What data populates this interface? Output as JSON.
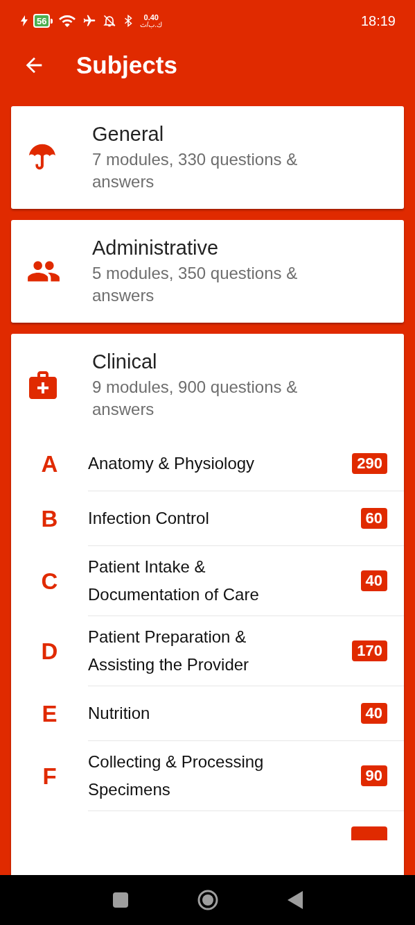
{
  "status_bar": {
    "battery": "56",
    "speed": "0.40",
    "speed_unit": "ك.ب/ث",
    "time": "18:19"
  },
  "app_bar": {
    "title": "Subjects"
  },
  "subjects": [
    {
      "title": "General",
      "summary": "7 modules, 330 questions & answers"
    },
    {
      "title": "Administrative",
      "summary": "5 modules, 350 questions & answers"
    },
    {
      "title": "Clinical",
      "summary": "9 modules, 900 questions & answers",
      "more_below": true,
      "modules": [
        {
          "letter": "A",
          "name": "Anatomy & Physiology",
          "count": "290"
        },
        {
          "letter": "B",
          "name": "Infection Control",
          "count": "60"
        },
        {
          "letter": "C",
          "name": "Patient Intake & Documentation of Care",
          "count": "40"
        },
        {
          "letter": "D",
          "name": "Patient Preparation & Assisting the Provider",
          "count": "170"
        },
        {
          "letter": "E",
          "name": "Nutrition",
          "count": "40"
        },
        {
          "letter": "F",
          "name": "Collecting & Processing Specimens",
          "count": "90"
        }
      ]
    }
  ]
}
